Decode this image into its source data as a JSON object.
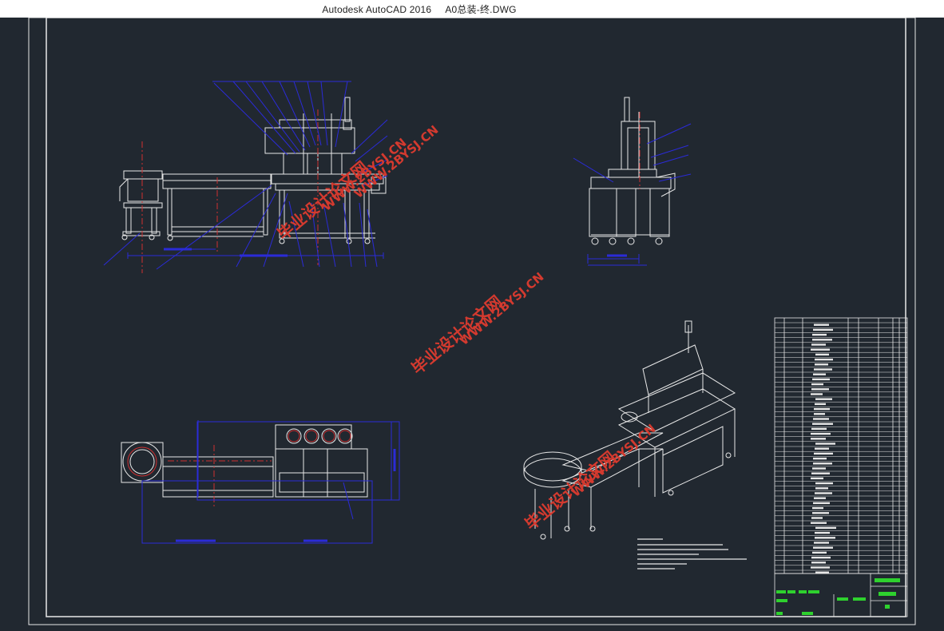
{
  "window": {
    "title_app": "Autodesk AutoCAD 2016",
    "title_file": "A0总装-终.DWG"
  },
  "watermarks": [
    {
      "label_cn": "毕业设计论文网",
      "label_url": "WWW.2BYSJ.CN"
    },
    {
      "label_cn": "毕业设计论文网",
      "label_url": "WWW.2BYSJ.CN"
    },
    {
      "label_cn": "毕业设计论文网",
      "label_url": "WWW.2BYSJ.CN"
    },
    {
      "label_cn": "毕业设计论文网",
      "label_url": "WWW.2BYSJ.CN"
    }
  ],
  "colors": {
    "background": "#212830",
    "line_white": "#e8e8e8",
    "line_blue": "#2b2bd8",
    "line_red": "#d03030",
    "line_green": "#2ed12e",
    "watermark": "#d43a2f"
  },
  "views": [
    "front-view",
    "side-view",
    "top-view",
    "isometric-view",
    "title-block"
  ]
}
